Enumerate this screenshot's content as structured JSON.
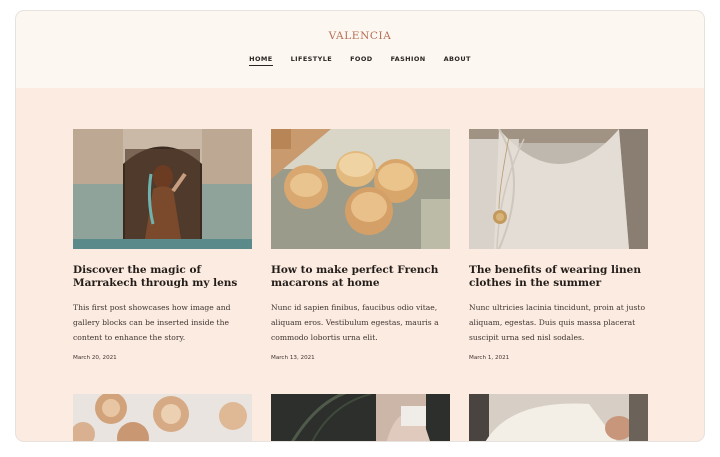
{
  "site": {
    "title": "VALENCIA"
  },
  "nav": [
    {
      "label": "HOME",
      "active": true
    },
    {
      "label": "LIFESTYLE",
      "active": false
    },
    {
      "label": "FOOD",
      "active": false
    },
    {
      "label": "FASHION",
      "active": false
    },
    {
      "label": "ABOUT",
      "active": false
    }
  ],
  "posts": [
    {
      "title": "Discover the magic of Marrakech through my lens",
      "excerpt": "This first post showcases how image and gallery blocks can be inserted inside the content to enhance the story.",
      "date": "March 20, 2021",
      "image": "woman-in-marrakech-doorway"
    },
    {
      "title": "How to make perfect French macarons at home",
      "excerpt": "Nunc id sapien finibus, faucibus odio vitae, aliquam eros. Vestibulum egestas, mauris a commodo lobortis urna elit.",
      "date": "March 13, 2021",
      "image": "macarons-on-plate"
    },
    {
      "title": "The benefits of wearing linen clothes in the summer",
      "excerpt": "Nunc ultricies lacinia tincidunt, proin at justo aliquam, egestas. Duis quis massa placerat suscipit urna sed nisl sodales.",
      "date": "March 1, 2021",
      "image": "linen-dress-with-pendant"
    }
  ],
  "more_posts": [
    {
      "image": "rose-pastries"
    },
    {
      "image": "palm-and-hands"
    },
    {
      "image": "white-blouse"
    }
  ],
  "colors": {
    "header_bg": "#fcf7f1",
    "page_bg": "#fcebe0",
    "brand": "#b56d53",
    "text": "#231d1a"
  }
}
